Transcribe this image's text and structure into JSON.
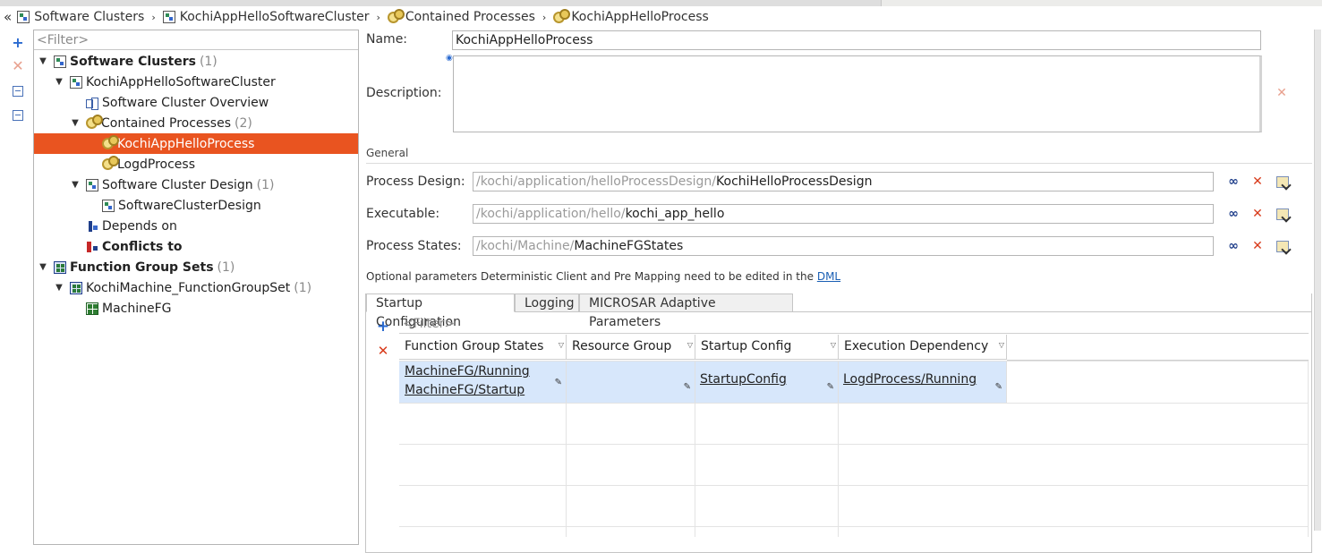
{
  "breadcrumb": {
    "back_glyph": "«",
    "items": [
      "Software Clusters",
      "KochiAppHelloSoftwareCluster",
      "Contained Processes",
      "KochiAppHelloProcess"
    ],
    "separator": "›"
  },
  "toolbar": {
    "add_icon": "+",
    "delete_icon": "✕"
  },
  "tree": {
    "filter_placeholder": "<Filter>",
    "nodes": {
      "software_clusters": {
        "label": "Software Clusters",
        "count": "(1)"
      },
      "kochi_cluster": {
        "label": "KochiAppHelloSoftwareCluster"
      },
      "overview": {
        "label": "Software Cluster Overview"
      },
      "contained_processes": {
        "label": "Contained Processes",
        "count": "(2)"
      },
      "hello_process": {
        "label": "KochiAppHelloProcess"
      },
      "logd_process": {
        "label": "LogdProcess"
      },
      "cluster_design": {
        "label": "Software Cluster Design",
        "count": "(1)"
      },
      "cluster_design_item": {
        "label": "SoftwareClusterDesign"
      },
      "depends_on": {
        "label": "Depends on"
      },
      "conflicts_to": {
        "label": "Conflicts to"
      },
      "function_group_sets": {
        "label": "Function Group Sets",
        "count": "(1)"
      },
      "machine_fgset": {
        "label": "KochiMachine_FunctionGroupSet",
        "count": "(1)"
      },
      "machine_fg": {
        "label": "MachineFG"
      }
    }
  },
  "form": {
    "name_label": "Name:",
    "name_value": "KochiAppHelloProcess",
    "description_label": "Description:",
    "description_value": "",
    "section_general": "General",
    "process_design": {
      "label": "Process Design:",
      "prefix": "/kochi/application/helloProcessDesign/",
      "value": "KochiHelloProcessDesign"
    },
    "executable": {
      "label": "Executable:",
      "prefix": "/kochi/application/hello/",
      "value": "kochi_app_hello"
    },
    "process_states": {
      "label": "Process States:",
      "prefix": "/kochi/Machine/",
      "value": "MachineFGStates"
    },
    "note": "Optional parameters Deterministic Client and Pre Mapping need to be edited in the",
    "note_link": "DML"
  },
  "tabs": [
    "Startup Configuration",
    "Logging",
    "MICROSAR Adaptive Parameters"
  ],
  "table": {
    "filter_placeholder": "<Filter>",
    "columns": [
      "Function Group States",
      "Resource Group",
      "Startup Config",
      "Execution Dependency"
    ],
    "rows": [
      {
        "function_group_states": [
          "MachineFG/Running",
          "MachineFG/Startup"
        ],
        "resource_group": "",
        "startup_config": "StartupConfig",
        "execution_dependency": "LogdProcess/Running"
      }
    ]
  },
  "colors": {
    "selection": "#e95420",
    "row_highlight": "#d7e7fb",
    "link": "#1a5fb4"
  }
}
